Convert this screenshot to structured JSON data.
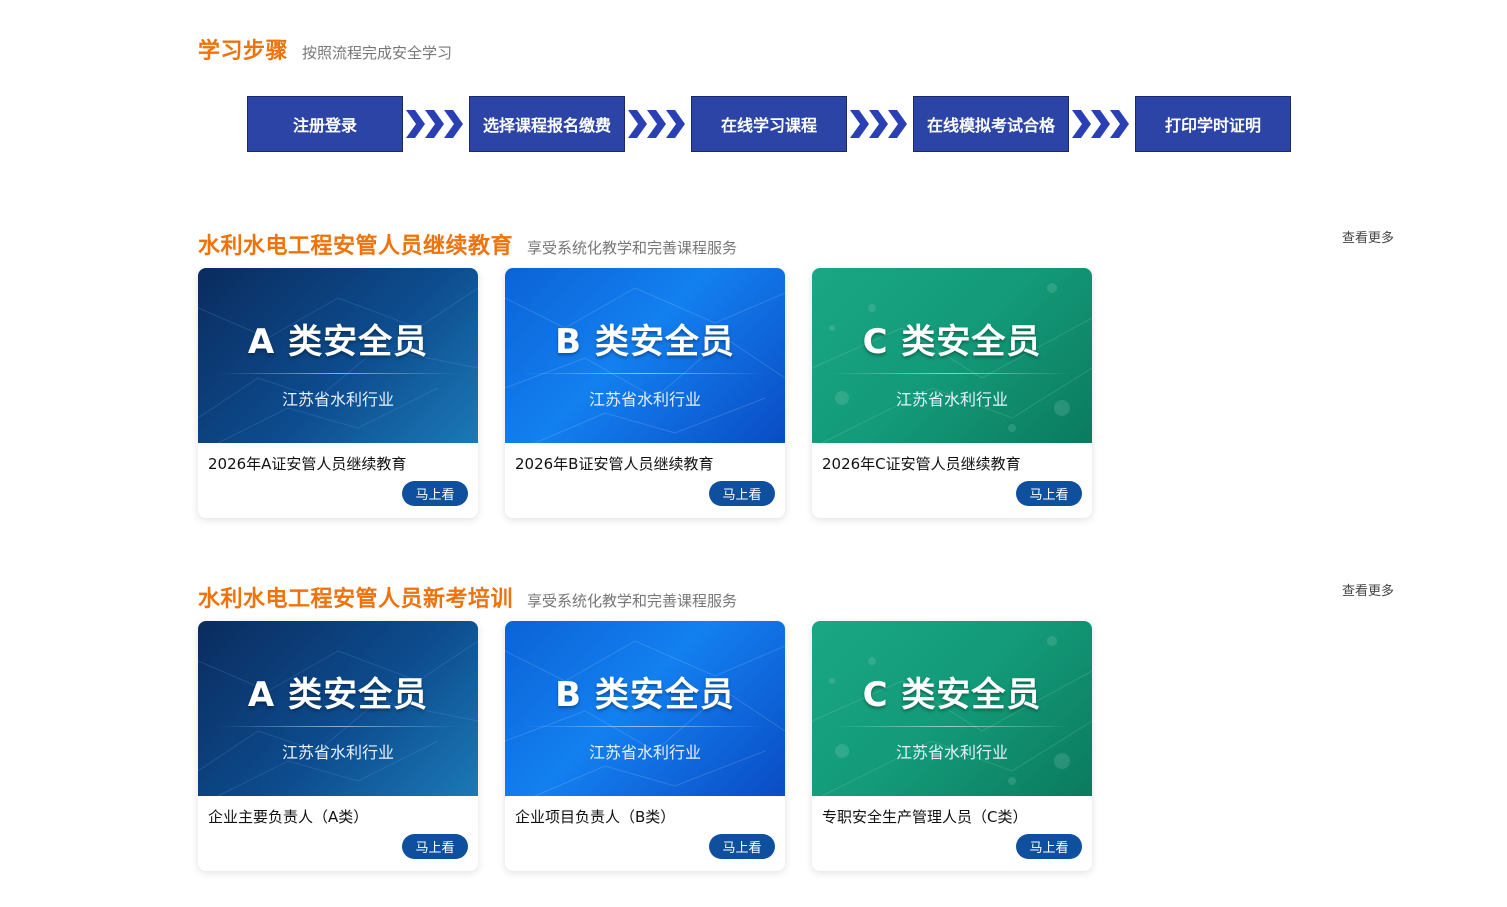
{
  "steps_section": {
    "title": "学习步骤",
    "subtitle": "按照流程完成安全学习",
    "steps": [
      "注册登录",
      "选择课程报名缴费",
      "在线学习课程",
      "在线模拟考试合格",
      "打印学时证明"
    ]
  },
  "sections": [
    {
      "title": "水利水电工程安管人员继续教育",
      "subtitle": "享受系统化教学和完善课程服务",
      "more": "查看更多",
      "cards": [
        {
          "thumb_title": "A 类安全员",
          "thumb_sub": "江苏省水利行业",
          "title": "2026年A证安管人员继续教育",
          "button": "马上看"
        },
        {
          "thumb_title": "B 类安全员",
          "thumb_sub": "江苏省水利行业",
          "title": "2026年B证安管人员继续教育",
          "button": "马上看"
        },
        {
          "thumb_title": "C 类安全员",
          "thumb_sub": "江苏省水利行业",
          "title": "2026年C证安管人员继续教育",
          "button": "马上看"
        }
      ]
    },
    {
      "title": "水利水电工程安管人员新考培训",
      "subtitle": "享受系统化教学和完善课程服务",
      "more": "查看更多",
      "cards": [
        {
          "thumb_title": "A 类安全员",
          "thumb_sub": "江苏省水利行业",
          "title": "企业主要负责人（A类）",
          "button": "马上看"
        },
        {
          "thumb_title": "B 类安全员",
          "thumb_sub": "江苏省水利行业",
          "title": "企业项目负责人（B类）",
          "button": "马上看"
        },
        {
          "thumb_title": "C 类安全员",
          "thumb_sub": "江苏省水利行业",
          "title": "专职安全生产管理人员（C类）",
          "button": "马上看"
        }
      ]
    }
  ],
  "colors": {
    "accent_orange": "#f0720a",
    "step_blue": "#2b44a6",
    "arrow_blue": "#2b3fb5",
    "button_blue": "#0e4f9e"
  },
  "icons": {
    "step_connector": "triple-chevron-right-icon"
  }
}
